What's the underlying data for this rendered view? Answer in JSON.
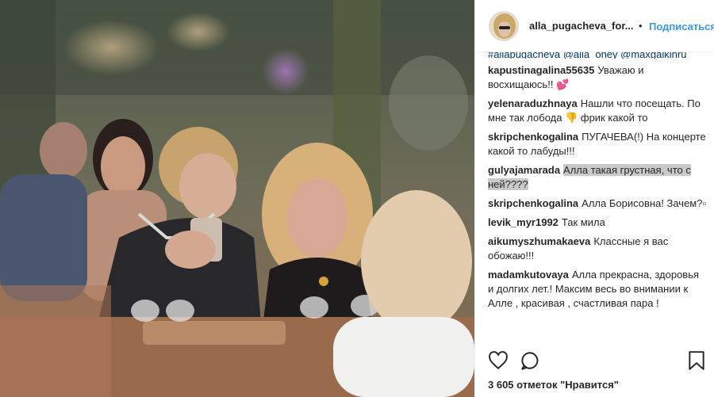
{
  "post": {
    "username": "alla_pugacheva_for...",
    "separator": "•",
    "follow_label": "Подписаться",
    "hashtags": "#allapugacheva @alla_oney @maxgalkinru",
    "comments": [
      {
        "author": "kapustinagalina55635",
        "text": "Уважаю и восхищаюсь!! 💕"
      },
      {
        "author": "yelenaraduzhnaya",
        "text": "Нашли что посещать. По мне так лобода 👎 фрик какой то"
      },
      {
        "author": "skripchenkogalina",
        "text": "ПУГАЧЕВА(!) На концерте какой то лабуды!!!"
      },
      {
        "author": "gulyajamarada",
        "text": "Алла такая грустная, что с ней????"
      },
      {
        "author": "skripchenkogalina",
        "text": "Алла Борисовна! Зачем?▫"
      },
      {
        "author": "levik_myr1992",
        "text": "Так мила"
      },
      {
        "author": "aikumyszhumakaeva",
        "text": "Классные я вас обожаю!!!"
      },
      {
        "author": "madamkutovaya",
        "text": "Алла прекрасна, здоровья и долгих лет.! Максим весь во внимании к Алле , красивая , счастливая пара !"
      }
    ],
    "likes_count": "3 605 отметок",
    "likes_label": "\"Нравится\"",
    "icons": [
      "heart-icon",
      "comment-icon",
      "bookmark-icon"
    ],
    "colors": {
      "link": "#3897f0",
      "hashtag": "#003569",
      "text": "#262626",
      "border": "#efefef"
    }
  }
}
